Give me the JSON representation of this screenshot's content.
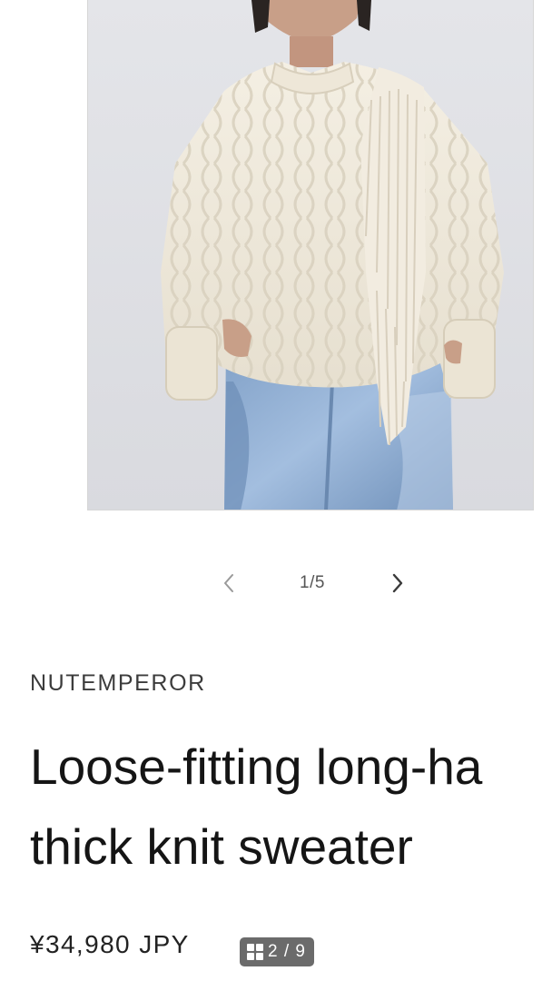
{
  "product": {
    "image_alt": "Model wearing cream cable-knit fringed sweater with light blue jeans",
    "brand": "NUTEMPEROR",
    "title_line_1": "Loose-fitting long-ha",
    "title_line_2": "thick knit sweater",
    "price": "¥34,980 JPY"
  },
  "pager": {
    "current": "1/5",
    "prev_icon": "chevron-left-icon",
    "next_icon": "chevron-right-icon"
  },
  "gallery_badge": {
    "icon": "grid-icon",
    "label": "2 / 9"
  },
  "colors": {
    "sweater": "#efe9dc",
    "denim": "#8faed2",
    "background": "#e1e2e7",
    "badge": "#6b6b6b"
  }
}
